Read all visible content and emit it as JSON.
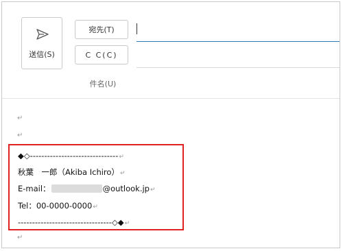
{
  "compose": {
    "send_label": "送信(S)",
    "to_label": "宛先(T)",
    "cc_label": "C C(C)",
    "subject_label": "件名(U)"
  },
  "body": {
    "paragraph_mark": "↵",
    "signature": {
      "line1_prefix": "◆◇",
      "line1_dashes": "-------------------------------",
      "name": "秋葉　一郎（Akiba Ichiro）",
      "email_label": "E-mail：",
      "email_domain": "@outlook.jp",
      "tel": "Tel：00-0000-0000",
      "line5_dashes": "---------------------------------",
      "line5_suffix": "◇◆"
    }
  },
  "colors": {
    "highlight_box": "#e02020",
    "field_underline_active": "#2b7bb9"
  }
}
